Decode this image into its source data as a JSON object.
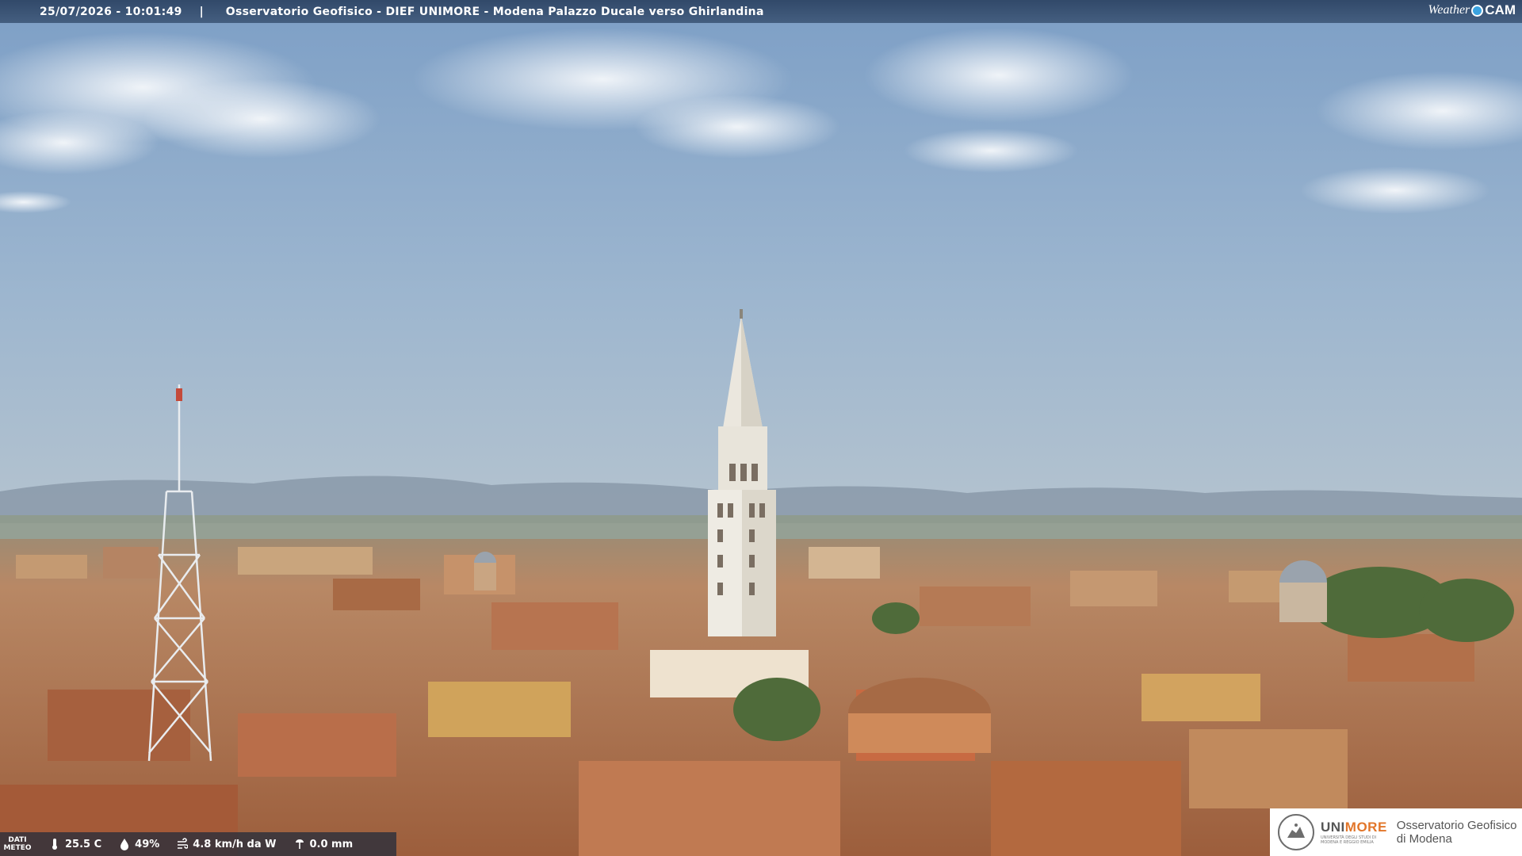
{
  "header": {
    "timestamp": "25/07/2026 - 10:01:49",
    "separator": "|",
    "caption": "Osservatorio Geofisico - DIEF UNIMORE - Modena Palazzo Ducale verso Ghirlandina",
    "brand_weather": "Weather",
    "brand_cam": "CAM"
  },
  "meteo": {
    "label_line1": "DATI",
    "label_line2": "METEO",
    "temperature": "25.5 C",
    "humidity": "49%",
    "wind": "4.8 km/h da W",
    "rain": "0.0 mm"
  },
  "logo": {
    "uni_part1": "UNI",
    "uni_part2": "MORE",
    "uni_sub": "UNIVERSITÀ DEGLI STUDI DI MODENA E REGGIO EMILIA",
    "obs_line1": "Osservatorio Geofisico",
    "obs_line2": "di Modena"
  },
  "colors": {
    "sky_top": "#7fa3c9",
    "sky_bottom": "#a9c0d6",
    "roof": "#b97a52",
    "tower": "#e9e6de",
    "accent_more": "#e2762a"
  }
}
